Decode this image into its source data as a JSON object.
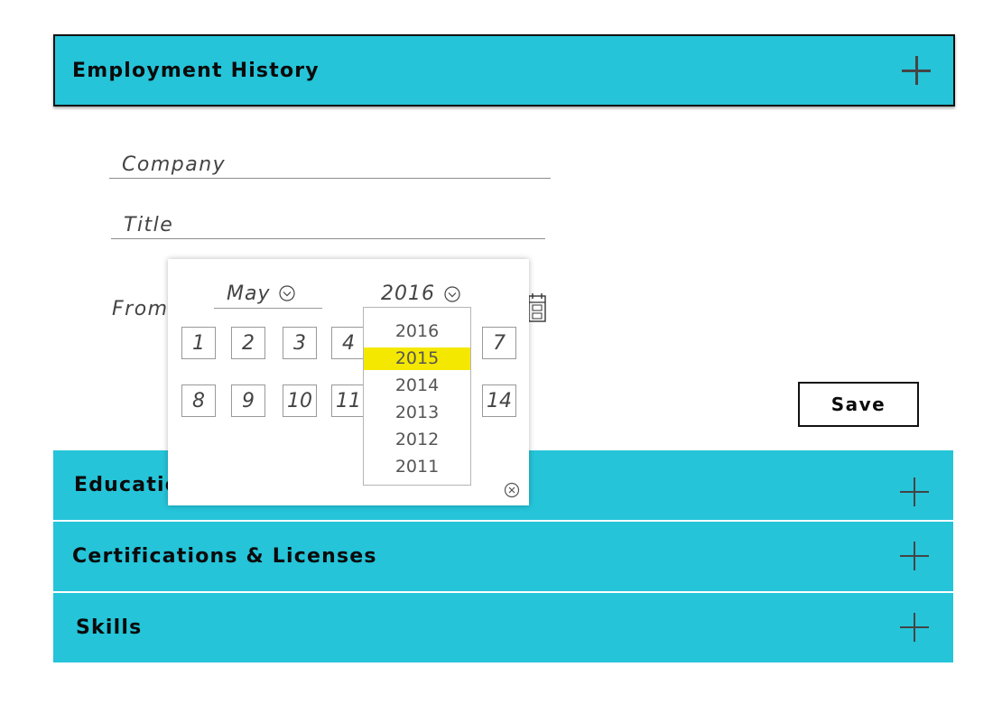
{
  "employment": {
    "title": "Employment History",
    "expand_icon": "plus-icon"
  },
  "form": {
    "company_placeholder": "Company",
    "title_placeholder": "Title",
    "from_label": "From",
    "calendar_icon": "calendar-icon",
    "save_label": "Save"
  },
  "date_picker": {
    "month": "May",
    "year": "2016",
    "days_row1": [
      "1",
      "2",
      "3",
      "4",
      "7"
    ],
    "days_row2": [
      "8",
      "9",
      "10",
      "11",
      "14"
    ],
    "year_options": [
      "2016",
      "2015",
      "2014",
      "2013",
      "2012",
      "2011"
    ],
    "highlighted_year": "2015",
    "highlight_color": "#f5e800",
    "close_icon": "close-circle-icon"
  },
  "sections": [
    {
      "title": "Education",
      "icon": "plus-icon"
    },
    {
      "title": "Certifications & Licenses",
      "icon": "plus-icon"
    },
    {
      "title": "Skills",
      "icon": "plus-icon"
    }
  ],
  "colors": {
    "accent": "#25c4d9",
    "border": "#111111"
  }
}
